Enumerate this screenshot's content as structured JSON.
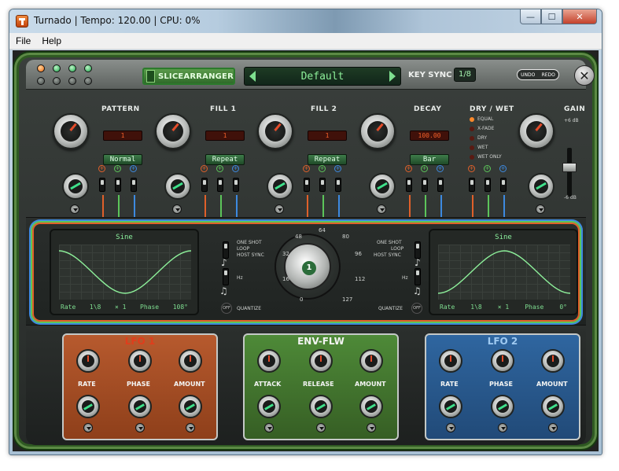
{
  "window": {
    "title": "Turnado | Tempo: 120.00 | CPU: 0%",
    "minimize": "—",
    "maximize": "☐",
    "close": "✕"
  },
  "menu": {
    "file": "File",
    "help": "Help"
  },
  "header": {
    "slicearranger": "SLICEARRANGER",
    "preset": "Default",
    "key_sync_label": "KEY SYNC",
    "key_sync_value": "1/8",
    "undo": "UNDO",
    "redo": "REDO",
    "close_symbol": "✕"
  },
  "controls": {
    "pattern": {
      "label": "PATTERN",
      "value": "1",
      "mode": "Normal"
    },
    "fill1": {
      "label": "FILL 1",
      "value": "1",
      "mode": "Repeat"
    },
    "fill2": {
      "label": "FILL 2",
      "value": "1",
      "mode": "Repeat"
    },
    "decay": {
      "label": "DECAY",
      "value": "100.00",
      "mode": "Bar"
    },
    "drywet": {
      "label": "DRY / WET",
      "options": [
        "EQUAL",
        "X-FADE",
        "DRY",
        "WET",
        "WET ONLY"
      ]
    },
    "gain": {
      "label": "GAIN",
      "top": "+6 dB",
      "bottom": "-6 dB"
    }
  },
  "lfo_display_left": {
    "wave": "Sine",
    "rate_label": "Rate",
    "rate_value": "1\\8",
    "mult": "× 1",
    "phase_label": "Phase",
    "phase_value": "108°"
  },
  "lfo_display_right": {
    "wave": "Sine",
    "rate_label": "Rate",
    "rate_value": "1\\8",
    "mult": "× 1",
    "phase_label": "Phase",
    "phase_value": "0°"
  },
  "sync_labels": {
    "one_shot": "ONE SHOT",
    "loop": "LOOP",
    "host_sync": "HOST SYNC",
    "hz": "Hz",
    "quantize": "QUANTIZE",
    "off": "OFF"
  },
  "center_knob": {
    "value": "1",
    "scale": [
      "0",
      "16",
      "32",
      "48",
      "64",
      "80",
      "96",
      "112",
      "127"
    ]
  },
  "modules": {
    "lfo1": {
      "title": "LFO 1",
      "knobs": [
        "RATE",
        "PHASE",
        "AMOUNT"
      ]
    },
    "env": {
      "title": "ENV-FLW",
      "knobs": [
        "ATTACK",
        "RELEASE",
        "AMOUNT"
      ]
    },
    "lfo2": {
      "title": "LFO 2",
      "knobs": [
        "RATE",
        "PHASE",
        "AMOUNT"
      ]
    }
  },
  "colors": {
    "orange": "#e0602a",
    "green": "#5cc55a",
    "blue": "#3d8ae0",
    "lcd_green": "#8df09a"
  }
}
